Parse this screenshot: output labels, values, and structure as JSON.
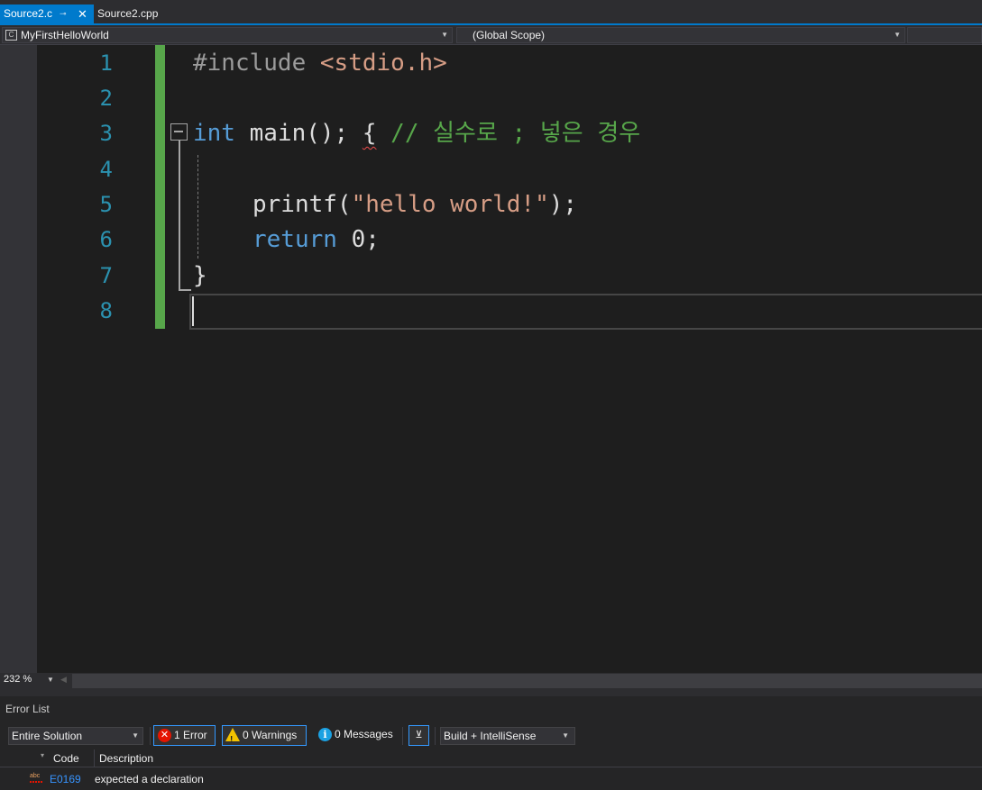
{
  "tabs": [
    {
      "label": "Source2.c",
      "active": true,
      "pin": "⊸",
      "close": "✕"
    },
    {
      "label": "Source2.cpp",
      "active": false
    }
  ],
  "navbar": {
    "project": "MyFirstHelloWorld",
    "scope": "(Global Scope)",
    "member": ""
  },
  "editor": {
    "line_numbers": [
      "1",
      "2",
      "3",
      "4",
      "5",
      "6",
      "7",
      "8"
    ],
    "line1": {
      "directive": "#include",
      "header": " <stdio.h>"
    },
    "line3": {
      "kw": "int",
      "rest": " main(); ",
      "brace": "{",
      "comment": " // 실수로 ; 넣은 경우"
    },
    "line5": {
      "func": "printf(",
      "str": "\"hello world!\"",
      "end": ");"
    },
    "line6": {
      "kw": "return",
      "rest": " 0;"
    },
    "line7": {
      "brace": "}"
    }
  },
  "zoom": {
    "level": "232 %"
  },
  "error_list": {
    "title": "Error List",
    "scope": "Entire Solution",
    "errors_label": "1 Error",
    "warnings_label": "0 Warnings",
    "messages_label": "0 Messages",
    "build_filter": "Build + IntelliSense",
    "columns": {
      "code": "Code",
      "description": "Description"
    },
    "rows": [
      {
        "code": "E0169",
        "description": "expected a declaration"
      }
    ]
  },
  "colors": {
    "accent": "#007acc",
    "keyword": "#569cd6",
    "string": "#d69d85",
    "comment": "#57a64a",
    "line_number": "#2b91af",
    "error": "#e51400"
  }
}
